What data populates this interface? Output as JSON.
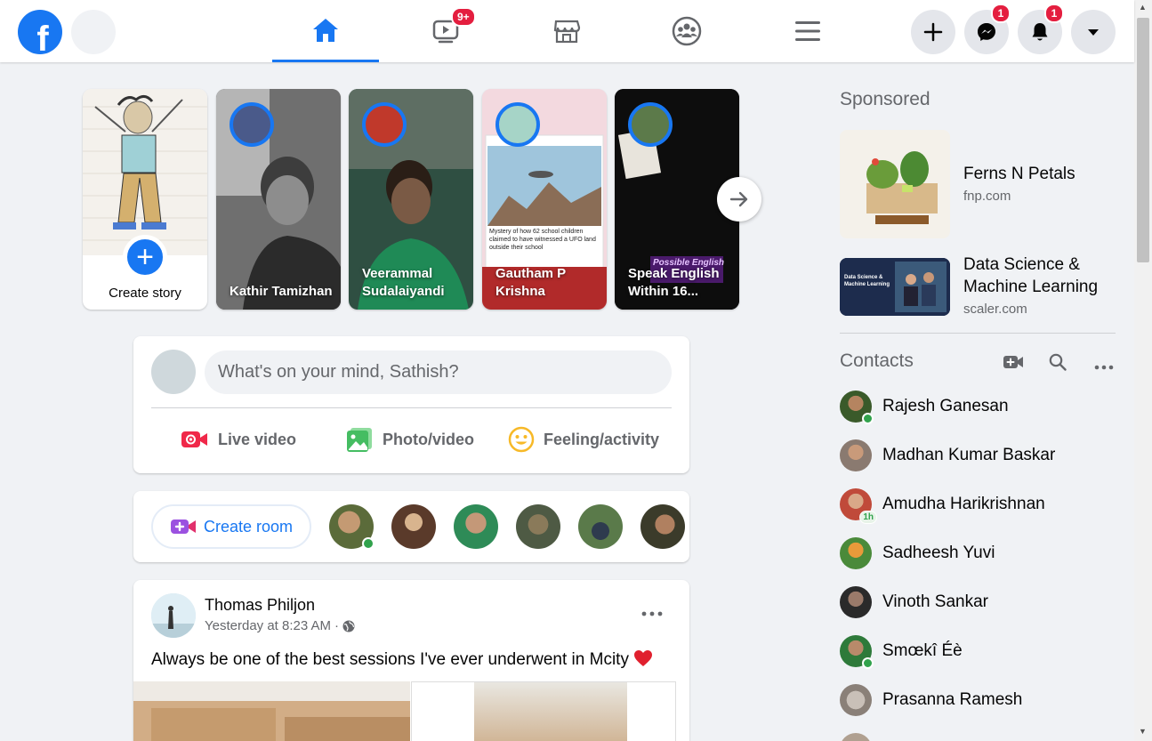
{
  "topbar": {
    "logo": "f",
    "nav": [
      {
        "id": "home",
        "icon": "home-icon",
        "active": true,
        "badge": ""
      },
      {
        "id": "watch",
        "icon": "watch-icon",
        "active": false,
        "badge": "9+"
      },
      {
        "id": "marketplace",
        "icon": "marketplace-icon",
        "active": false,
        "badge": ""
      },
      {
        "id": "groups",
        "icon": "groups-icon",
        "active": false,
        "badge": ""
      },
      {
        "id": "menu",
        "icon": "menu-icon",
        "active": false,
        "badge": ""
      }
    ],
    "right": {
      "create_icon": "plus-icon",
      "messenger_badge": "1",
      "notifications_badge": "1",
      "account_icon": "caret-down-icon"
    },
    "accent": "#1877f2",
    "badge_color": "#e41e3f"
  },
  "stories": {
    "create_label": "Create story",
    "items": [
      {
        "name": "Kathir Tamizhan"
      },
      {
        "name": "Veerammal Sudalaiyandi"
      },
      {
        "name": "Gautham P Krishna"
      },
      {
        "name": "Speak English Within 16..."
      }
    ],
    "story2_caption": "Mystery of how 62 school children claimed to have witnessed a UFO land outside their school",
    "story3_banner": "Possible English"
  },
  "composer": {
    "placeholder": "What's on your mind, Sathish?",
    "actions": [
      {
        "label": "Live video",
        "icon": "live-video-icon",
        "color": "#f02849"
      },
      {
        "label": "Photo/video",
        "icon": "photo-icon",
        "color": "#45bd62"
      },
      {
        "label": "Feeling/activity",
        "icon": "feeling-icon",
        "color": "#f7b928"
      }
    ]
  },
  "rooms": {
    "create_label": "Create room"
  },
  "post": {
    "author": "Thomas Philjon",
    "time": "Yesterday at 8:23 AM",
    "separator": "·",
    "text": "Always be one of the best sessions I've ever underwent in Mcity"
  },
  "sidebar": {
    "sponsored_label": "Sponsored",
    "ads": [
      {
        "title": "Ferns N Petals",
        "domain": "fnp.com"
      },
      {
        "title": "Data Science & Machine Learning",
        "domain": "scaler.com"
      }
    ],
    "ad2_thumb_text": "Data Science & Machine Learning",
    "contacts_label": "Contacts",
    "contacts": [
      {
        "name": "Rajesh Ganesan",
        "online": true,
        "away": ""
      },
      {
        "name": "Madhan Kumar Baskar",
        "online": false,
        "away": ""
      },
      {
        "name": "Amudha Harikrishnan",
        "online": false,
        "away": "1h"
      },
      {
        "name": "Sadheesh Yuvi",
        "online": false,
        "away": ""
      },
      {
        "name": "Vinoth Sankar",
        "online": false,
        "away": ""
      },
      {
        "name": "Smœkî Éè",
        "online": true,
        "away": ""
      },
      {
        "name": "Prasanna Ramesh",
        "online": false,
        "away": ""
      }
    ]
  }
}
